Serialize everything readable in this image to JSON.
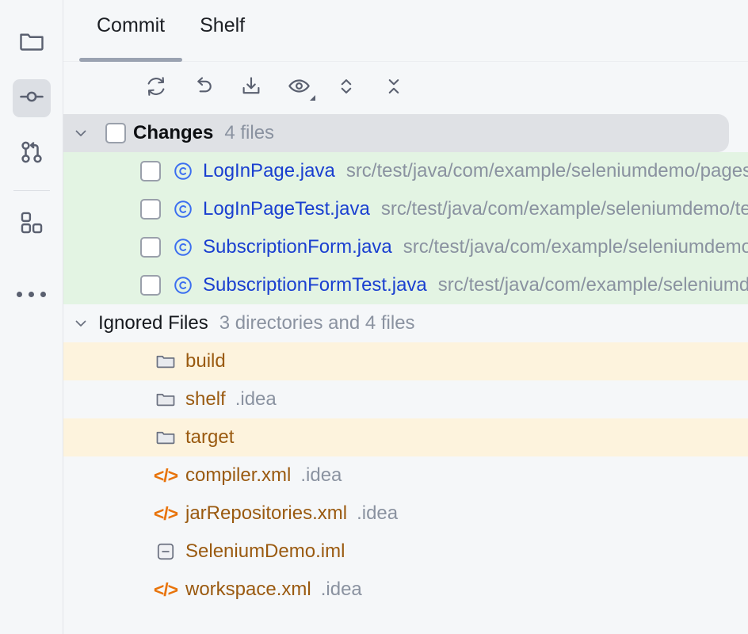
{
  "sidebar": {
    "items": [
      {
        "name": "project-tool-window",
        "icon": "folder-icon",
        "selected": false
      },
      {
        "name": "commit-tool-window",
        "icon": "commit-icon",
        "selected": true
      },
      {
        "name": "pull-requests-tool-window",
        "icon": "pull-request-icon",
        "selected": false
      },
      {
        "name": "plugins-tool-window",
        "icon": "plugins-grid-icon",
        "selected": false
      },
      {
        "name": "more-tool-windows",
        "icon": "more-ellipsis-icon",
        "selected": false
      }
    ]
  },
  "tabs": [
    {
      "label": "Commit",
      "active": true
    },
    {
      "label": "Shelf",
      "active": false
    }
  ],
  "toolbar": {
    "buttons": [
      {
        "name": "refresh-changes-button",
        "icon": "refresh-icon"
      },
      {
        "name": "rollback-button",
        "icon": "revert-arrow-icon"
      },
      {
        "name": "update-project-button",
        "icon": "download-tray-icon"
      },
      {
        "name": "show-diff-preview-button",
        "icon": "eye-icon",
        "has_dropdown": true
      },
      {
        "name": "expand-all-button",
        "icon": "expand-chevrons-icon"
      },
      {
        "name": "collapse-all-button",
        "icon": "collapse-chevrons-icon"
      }
    ]
  },
  "tree": {
    "changes_group": {
      "label": "Changes",
      "count": "4 files",
      "expanded": true,
      "checked": false,
      "files": [
        {
          "name": "LogInPage.java",
          "path": "src/test/java/com/example/seleniumdemo/pages",
          "icon": "java-class-icon",
          "checked": false,
          "status": "added"
        },
        {
          "name": "LogInPageTest.java",
          "path": "src/test/java/com/example/seleniumdemo/tests",
          "icon": "java-class-icon",
          "checked": false,
          "status": "added"
        },
        {
          "name": "SubscriptionForm.java",
          "path": "src/test/java/com/example/seleniumdemo/pages",
          "icon": "java-class-icon",
          "checked": false,
          "status": "added"
        },
        {
          "name": "SubscriptionFormTest.java",
          "path": "src/test/java/com/example/seleniumdemo/tests",
          "icon": "java-class-icon",
          "checked": false,
          "status": "added"
        }
      ]
    },
    "ignored_group": {
      "label": "Ignored Files",
      "count": "3 directories and 4 files",
      "expanded": true,
      "entries": [
        {
          "name": "build",
          "path": "",
          "icon": "folder-icon",
          "highlight": true
        },
        {
          "name": "shelf",
          "path": ".idea",
          "icon": "folder-icon",
          "highlight": false
        },
        {
          "name": "target",
          "path": "",
          "icon": "folder-icon",
          "highlight": true
        },
        {
          "name": "compiler.xml",
          "path": ".idea",
          "icon": "xml-code-icon",
          "highlight": false
        },
        {
          "name": "jarRepositories.xml",
          "path": ".idea",
          "icon": "xml-code-icon",
          "highlight": false
        },
        {
          "name": "SeleniumDemo.iml",
          "path": "",
          "icon": "module-iml-icon",
          "highlight": false
        },
        {
          "name": "workspace.xml",
          "path": ".idea",
          "icon": "xml-code-icon",
          "highlight": false
        }
      ]
    }
  },
  "colors": {
    "added_row": "#e3f4e3",
    "ignored_row": "#fdf3dd",
    "panel_bg": "#f5f7f9",
    "selected_row": "#dfe1e5",
    "java_name": "#1a3fd0",
    "ignored_name": "#9a5a10",
    "xml_icon": "#e8730a",
    "path_gray": "#8a92a0",
    "tab_underline": "#9aa2b1"
  }
}
